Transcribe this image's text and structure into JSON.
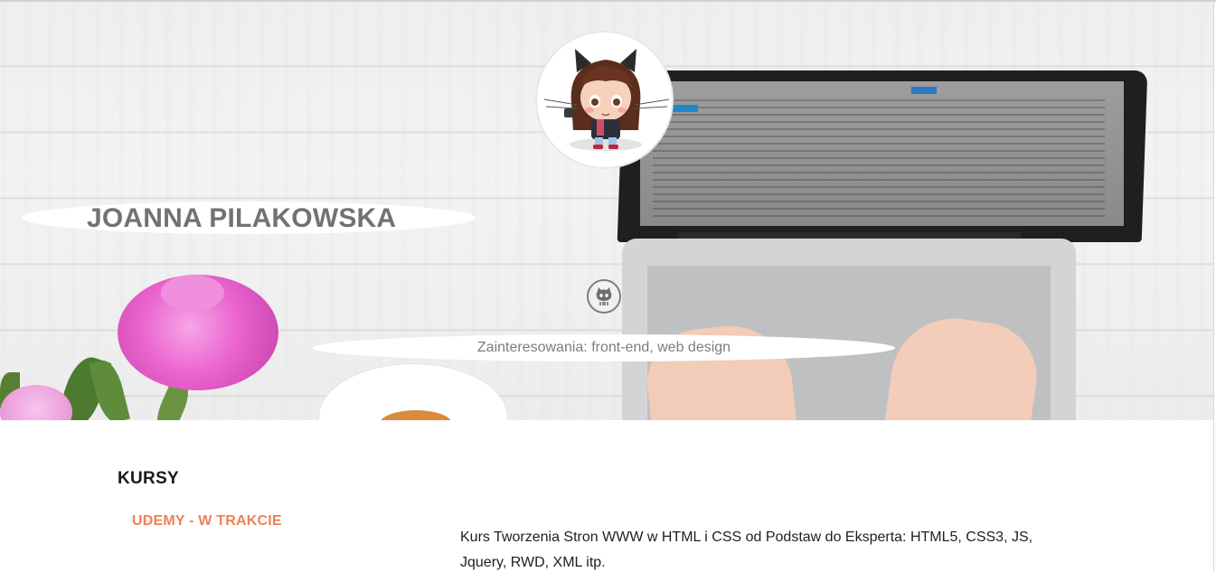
{
  "hero": {
    "name": "JOANNA PILAKOWSKA",
    "interests": "Zainteresowania: front-end, web design",
    "avatar_icon": "octocat-avatar-icon",
    "github_icon": "github-icon"
  },
  "content": {
    "courses_heading": "KURSY",
    "course_subheading": "UDEMY - W TRAKCIE",
    "course_description": "Kurs Tworzenia Stron WWW w HTML i CSS od Podstaw do Eksperta: HTML5, CSS3, JS, Jquery, RWD, XML itp."
  },
  "colors": {
    "accent": "#f07f56",
    "name_text": "#727272",
    "body_text": "#1f1f1f"
  }
}
